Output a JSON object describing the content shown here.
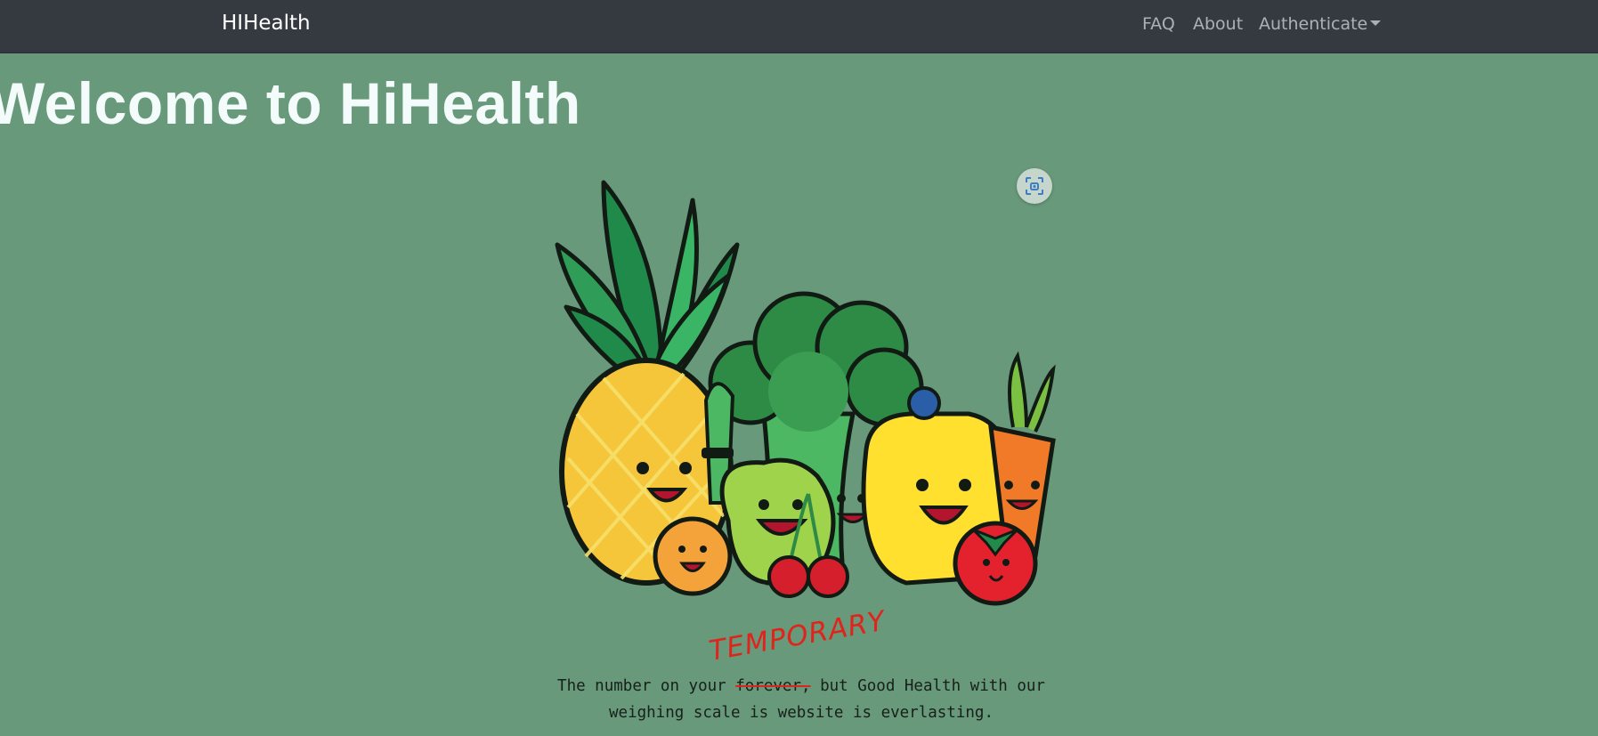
{
  "navbar": {
    "brand": "HIHealth",
    "links": [
      "FAQ",
      "About"
    ],
    "dropdown_label": "Authenticate"
  },
  "hero": {
    "title": "Welcome to HiHealth",
    "tagline_before": "The number on your",
    "tagline_struck": "forever,",
    "tagline_after": "but Good Health with our weighing scale is",
    "tagline_end": "website is everlasting.",
    "overwrite_text": "TEMPORARY"
  },
  "colors": {
    "navbar_bg": "#343a40",
    "page_bg": "#67997a",
    "title": "#f3fbfb",
    "handwriting": "#e0241c"
  },
  "icons": {
    "image_search": "image-search-icon"
  }
}
